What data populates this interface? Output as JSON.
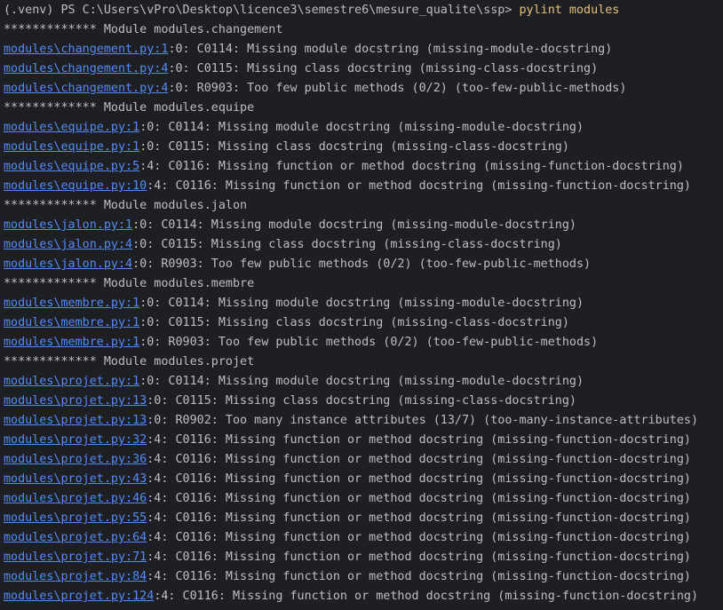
{
  "prompt": {
    "path": "(.venv) PS C:\\Users\\vPro\\Desktop\\licence3\\semestre6\\mesure_qualite\\ssp> ",
    "command": "pylint modules"
  },
  "output": [
    {
      "kind": "header",
      "text": "************* Module modules.changement"
    },
    {
      "kind": "issue",
      "link": "modules\\changement.py:1",
      "rest": ":0: C0114: Missing module docstring (missing-module-docstring)"
    },
    {
      "kind": "issue",
      "link": "modules\\changement.py:4",
      "rest": ":0: C0115: Missing class docstring (missing-class-docstring)"
    },
    {
      "kind": "issue",
      "link": "modules\\changement.py:4",
      "rest": ":0: R0903: Too few public methods (0/2) (too-few-public-methods)"
    },
    {
      "kind": "header",
      "text": "************* Module modules.equipe"
    },
    {
      "kind": "issue",
      "link": "modules\\equipe.py:1",
      "rest": ":0: C0114: Missing module docstring (missing-module-docstring)"
    },
    {
      "kind": "issue",
      "link": "modules\\equipe.py:1",
      "rest": ":0: C0115: Missing class docstring (missing-class-docstring)"
    },
    {
      "kind": "issue",
      "link": "modules\\equipe.py:5",
      "rest": ":4: C0116: Missing function or method docstring (missing-function-docstring)"
    },
    {
      "kind": "issue",
      "link": "modules\\equipe.py:10",
      "rest": ":4: C0116: Missing function or method docstring (missing-function-docstring)"
    },
    {
      "kind": "header",
      "text": "************* Module modules.jalon"
    },
    {
      "kind": "issue",
      "link": "modules\\jalon.py:1",
      "rest": ":0: C0114: Missing module docstring (missing-module-docstring)"
    },
    {
      "kind": "issue",
      "link": "modules\\jalon.py:4",
      "rest": ":0: C0115: Missing class docstring (missing-class-docstring)"
    },
    {
      "kind": "issue",
      "link": "modules\\jalon.py:4",
      "rest": ":0: R0903: Too few public methods (0/2) (too-few-public-methods)"
    },
    {
      "kind": "header",
      "text": "************* Module modules.membre"
    },
    {
      "kind": "issue",
      "link": "modules\\membre.py:1",
      "rest": ":0: C0114: Missing module docstring (missing-module-docstring)"
    },
    {
      "kind": "issue",
      "link": "modules\\membre.py:1",
      "rest": ":0: C0115: Missing class docstring (missing-class-docstring)"
    },
    {
      "kind": "issue",
      "link": "modules\\membre.py:1",
      "rest": ":0: R0903: Too few public methods (0/2) (too-few-public-methods)"
    },
    {
      "kind": "header",
      "text": "************* Module modules.projet"
    },
    {
      "kind": "issue",
      "link": "modules\\projet.py:1",
      "rest": ":0: C0114: Missing module docstring (missing-module-docstring)"
    },
    {
      "kind": "issue",
      "link": "modules\\projet.py:13",
      "rest": ":0: C0115: Missing class docstring (missing-class-docstring)"
    },
    {
      "kind": "issue",
      "link": "modules\\projet.py:13",
      "rest": ":0: R0902: Too many instance attributes (13/7) (too-many-instance-attributes)"
    },
    {
      "kind": "issue",
      "link": "modules\\projet.py:32",
      "rest": ":4: C0116: Missing function or method docstring (missing-function-docstring)"
    },
    {
      "kind": "issue",
      "link": "modules\\projet.py:36",
      "rest": ":4: C0116: Missing function or method docstring (missing-function-docstring)"
    },
    {
      "kind": "issue",
      "link": "modules\\projet.py:43",
      "rest": ":4: C0116: Missing function or method docstring (missing-function-docstring)"
    },
    {
      "kind": "issue",
      "link": "modules\\projet.py:46",
      "rest": ":4: C0116: Missing function or method docstring (missing-function-docstring)"
    },
    {
      "kind": "issue",
      "link": "modules\\projet.py:55",
      "rest": ":4: C0116: Missing function or method docstring (missing-function-docstring)"
    },
    {
      "kind": "issue",
      "link": "modules\\projet.py:64",
      "rest": ":4: C0116: Missing function or method docstring (missing-function-docstring)"
    },
    {
      "kind": "issue",
      "link": "modules\\projet.py:71",
      "rest": ":4: C0116: Missing function or method docstring (missing-function-docstring)"
    },
    {
      "kind": "issue",
      "link": "modules\\projet.py:84",
      "rest": ":4: C0116: Missing function or method docstring (missing-function-docstring)"
    },
    {
      "kind": "issue",
      "link": "modules\\projet.py:124",
      "rest": ":4: C0116: Missing function or method docstring (missing-function-docstring)"
    }
  ],
  "colors": {
    "background": "#1e1f22",
    "text": "#bcbec4",
    "link": "#548af7",
    "command": "#e5c07b"
  }
}
